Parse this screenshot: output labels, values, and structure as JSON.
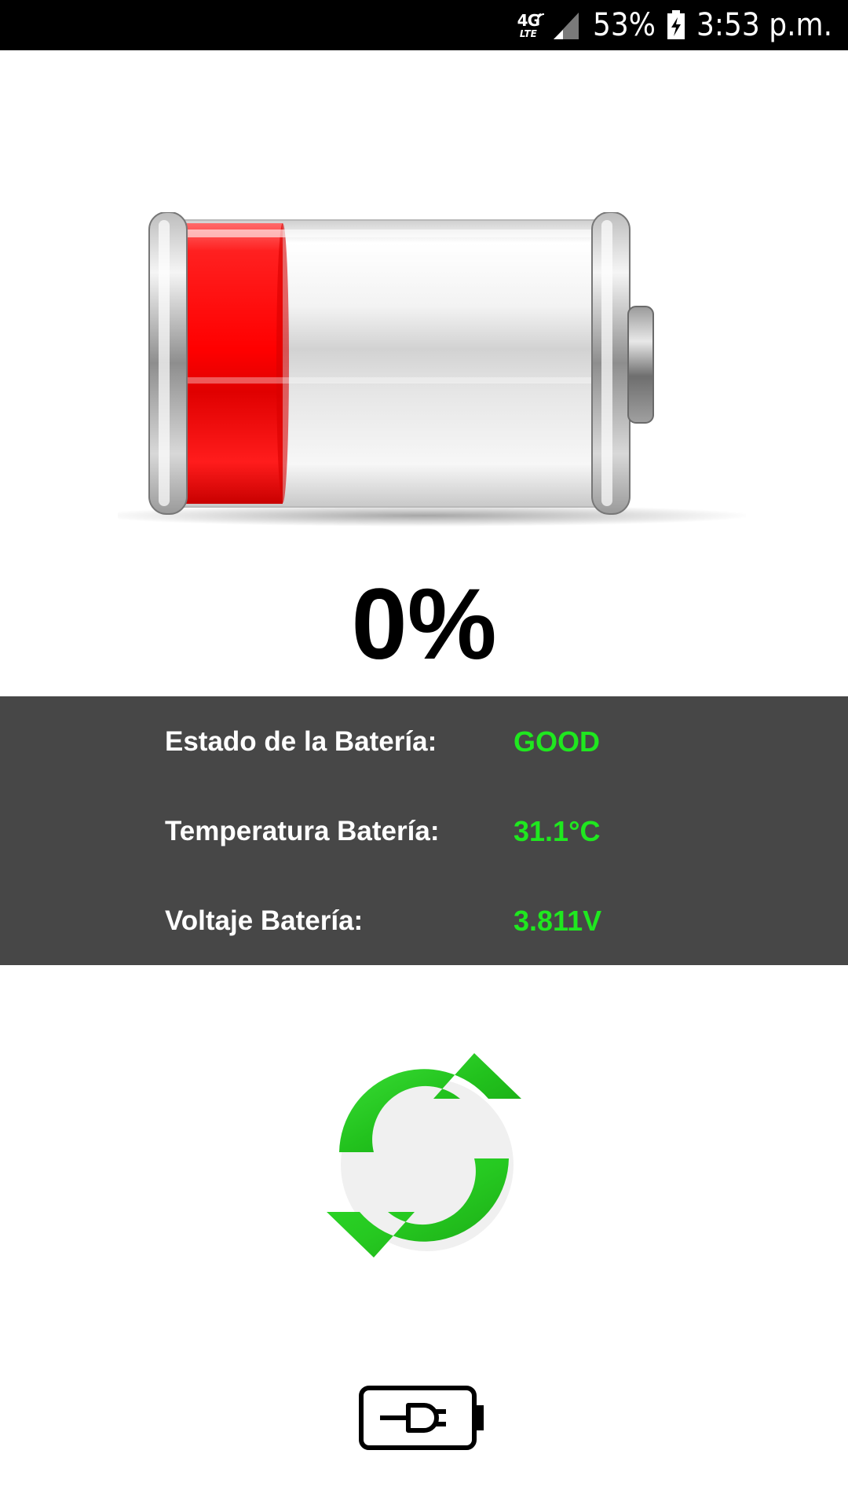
{
  "status_bar": {
    "network_type": "4G",
    "network_sub": "LTE",
    "battery_percent": "53%",
    "time": "3:53 p.m."
  },
  "battery": {
    "level_fraction": 0.0,
    "percent_label": "0%"
  },
  "info": {
    "rows": [
      {
        "label": "Estado de la Batería:",
        "value": "GOOD"
      },
      {
        "label": "Temperatura Batería:",
        "value": "31.1°C"
      },
      {
        "label": "Voltaje Batería:",
        "value": "3.811V"
      }
    ]
  },
  "icons": {
    "refresh": "refresh-icon",
    "charge": "battery-plug-icon"
  },
  "colors": {
    "panel_bg": "#474747",
    "value_green": "#1fe81f",
    "battery_red": "#ff1a1a",
    "refresh_green": "#22c21d"
  }
}
